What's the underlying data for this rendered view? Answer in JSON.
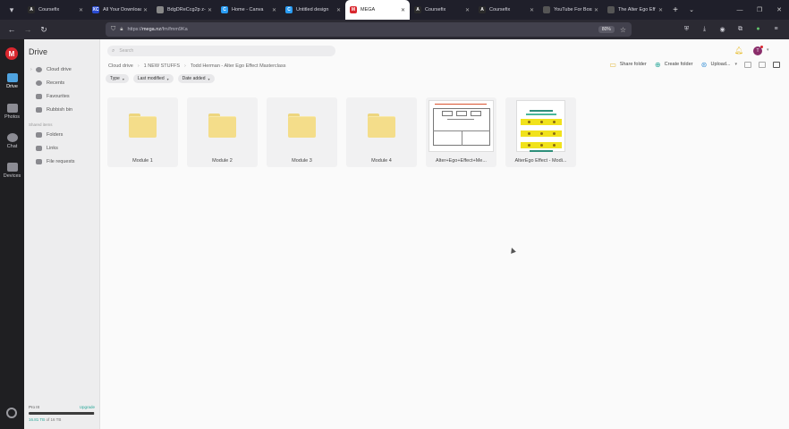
{
  "browser": {
    "tabs": [
      {
        "title": "Coursefix",
        "fav_letter": "A",
        "fav_color": "#2b2b2b"
      },
      {
        "title": "All Your Downloads",
        "fav_letter": "XC",
        "fav_color": "#2a4bd1"
      },
      {
        "title": "BdgDReCcg2p z-0-y-r",
        "fav_letter": "",
        "fav_color": "#888888"
      },
      {
        "title": "Home - Canva",
        "fav_letter": "C",
        "fav_color": "#2a9df4"
      },
      {
        "title": "Untitled design",
        "fav_letter": "C",
        "fav_color": "#2a9df4"
      },
      {
        "title": "MEGA",
        "fav_letter": "M",
        "fav_color": "#d9272e"
      },
      {
        "title": "Coursefix",
        "fav_letter": "A",
        "fav_color": "#2b2b2b"
      },
      {
        "title": "Coursefix",
        "fav_letter": "A",
        "fav_color": "#2b2b2b"
      },
      {
        "title": "YouTube For Bosses",
        "fav_letter": "",
        "fav_color": "#555555"
      },
      {
        "title": "The Alter Ego Eff",
        "fav_letter": "",
        "fav_color": "#555555"
      }
    ],
    "active_tab_index": 5,
    "url_prefix": "https://",
    "url_host": "mega.nz",
    "url_path": "/fm/fmm9Ka",
    "zoom": "80%"
  },
  "rail": {
    "items": [
      {
        "label": "Drive"
      },
      {
        "label": "Photos"
      },
      {
        "label": "Chat"
      },
      {
        "label": "Devices"
      }
    ]
  },
  "sidebar": {
    "title": "Drive",
    "items": [
      {
        "label": "Cloud drive"
      },
      {
        "label": "Recents"
      },
      {
        "label": "Favourites"
      },
      {
        "label": "Rubbish bin"
      }
    ],
    "section": "Shared items",
    "shared": [
      {
        "label": "Folders"
      },
      {
        "label": "Links"
      },
      {
        "label": "File requests"
      }
    ],
    "storage": {
      "plan": "Pro III",
      "upgrade": "Upgrade",
      "used": "16.81 TB",
      "total": " of 16 TB",
      "used_fraction": 0.98
    }
  },
  "topbar": {
    "search_placeholder": "Search",
    "avatar_letter": "T"
  },
  "breadcrumb": [
    "Cloud drive",
    "1 NEW STUFFS",
    "Todd Herman - Alter Ego Effect Masterclass"
  ],
  "actions": {
    "share_folder": "Share folder",
    "create_folder": "Create folder",
    "upload": "Upload..."
  },
  "filters": [
    "Type",
    "Last modified",
    "Date added"
  ],
  "items": [
    {
      "name": "Module 1",
      "kind": "folder"
    },
    {
      "name": "Module 2",
      "kind": "folder"
    },
    {
      "name": "Module 3",
      "kind": "folder"
    },
    {
      "name": "Module 4",
      "kind": "folder"
    },
    {
      "name": "Alter+Ego+Effect+Me...",
      "kind": "doc1"
    },
    {
      "name": "AlterEgo Effect - Modi...",
      "kind": "doc2"
    }
  ],
  "colors": {
    "mega_red": "#d9272e",
    "folder_yellow": "#f4dd8a",
    "accent_teal": "#2ba89a"
  }
}
